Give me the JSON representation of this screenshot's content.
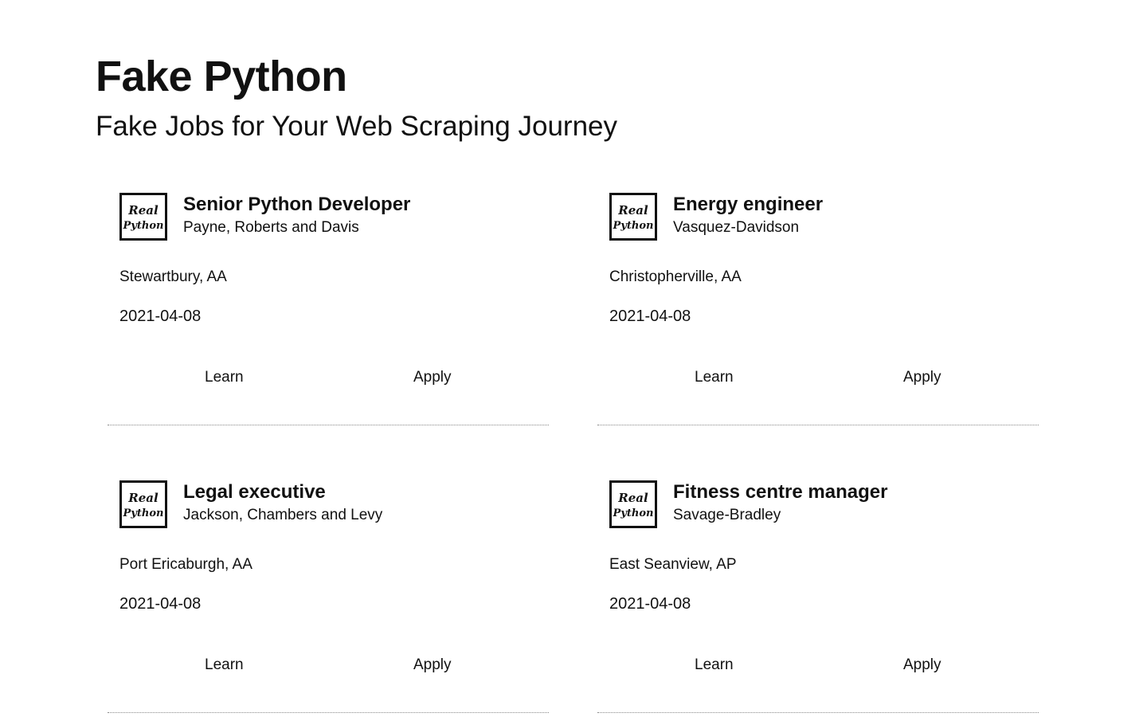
{
  "hero": {
    "title": "Fake Python",
    "subtitle": "Fake Jobs for Your Web Scraping Journey"
  },
  "logo": {
    "line1": "Real",
    "line2": "Python"
  },
  "jobs": [
    {
      "title": "Senior Python Developer",
      "company": "Payne, Roberts and Davis",
      "location": "Stewartbury, AA",
      "date": "2021-04-08",
      "learn_label": "Learn",
      "apply_label": "Apply"
    },
    {
      "title": "Energy engineer",
      "company": "Vasquez-Davidson",
      "location": "Christopherville, AA",
      "date": "2021-04-08",
      "learn_label": "Learn",
      "apply_label": "Apply"
    },
    {
      "title": "Legal executive",
      "company": "Jackson, Chambers and Levy",
      "location": "Port Ericaburgh, AA",
      "date": "2021-04-08",
      "learn_label": "Learn",
      "apply_label": "Apply"
    },
    {
      "title": "Fitness centre manager",
      "company": "Savage-Bradley",
      "location": "East Seanview, AP",
      "date": "2021-04-08",
      "learn_label": "Learn",
      "apply_label": "Apply"
    }
  ]
}
